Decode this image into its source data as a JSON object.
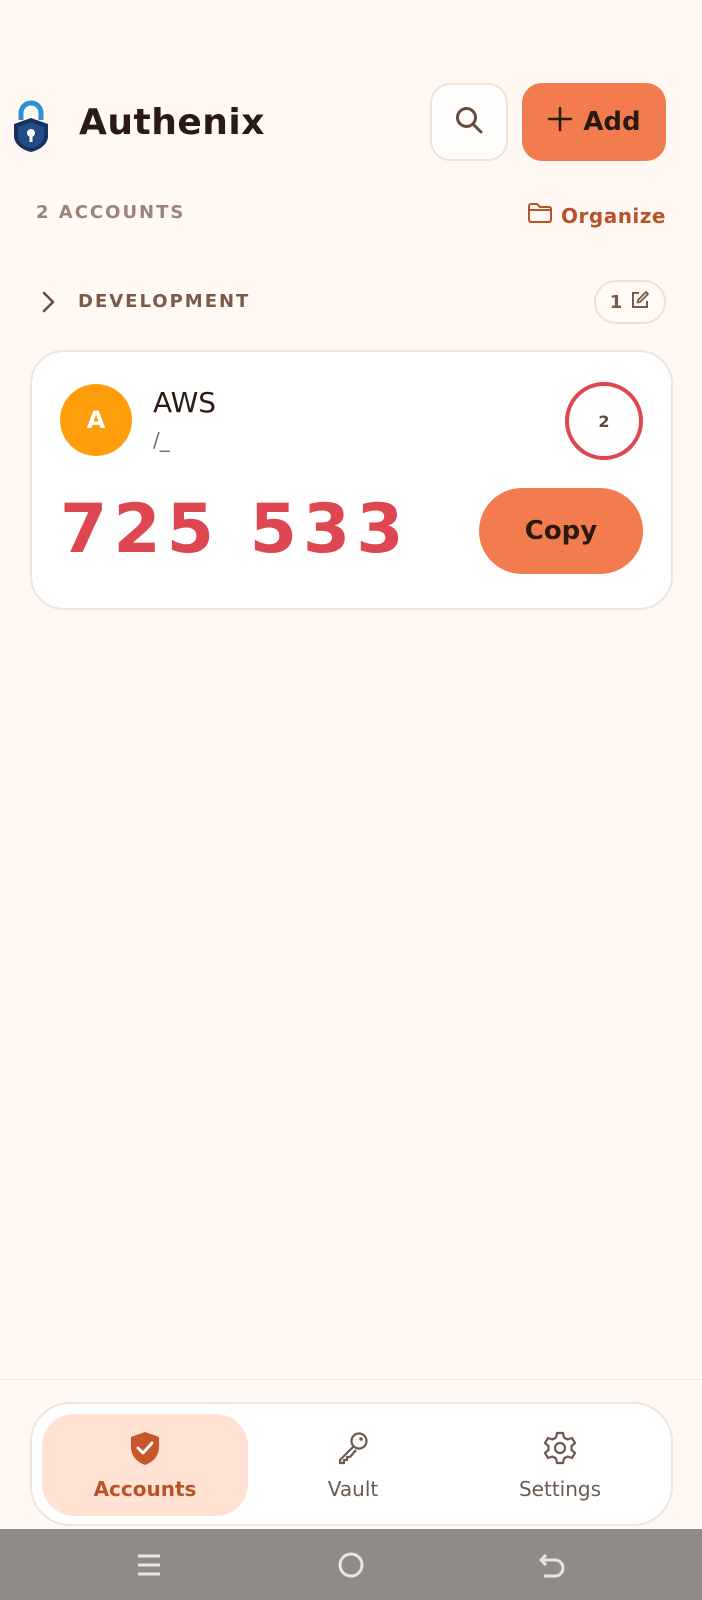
{
  "header": {
    "app_title": "Authenix",
    "add_label": "Add"
  },
  "summary": {
    "count_label": "2 ACCOUNTS",
    "organize_label": "Organize"
  },
  "group": {
    "name": "DEVELOPMENT",
    "badge_count": "1"
  },
  "account": {
    "avatar_letter": "A",
    "name": "AWS",
    "subtitle": "/_",
    "timer_seconds": "2",
    "code": "725 533",
    "copy_label": "Copy"
  },
  "nav": {
    "items": [
      {
        "label": "Accounts",
        "icon": "shield-check-icon",
        "active": true
      },
      {
        "label": "Vault",
        "icon": "key-icon",
        "active": false
      },
      {
        "label": "Settings",
        "icon": "gear-icon",
        "active": false
      }
    ]
  },
  "system_nav": {
    "icons": [
      "menu-icon",
      "home-icon",
      "back-icon"
    ]
  },
  "colors": {
    "accent": "#f37c4e",
    "code_red": "#de4652",
    "avatar": "#ff9d0a",
    "background": "#fff8f3"
  }
}
